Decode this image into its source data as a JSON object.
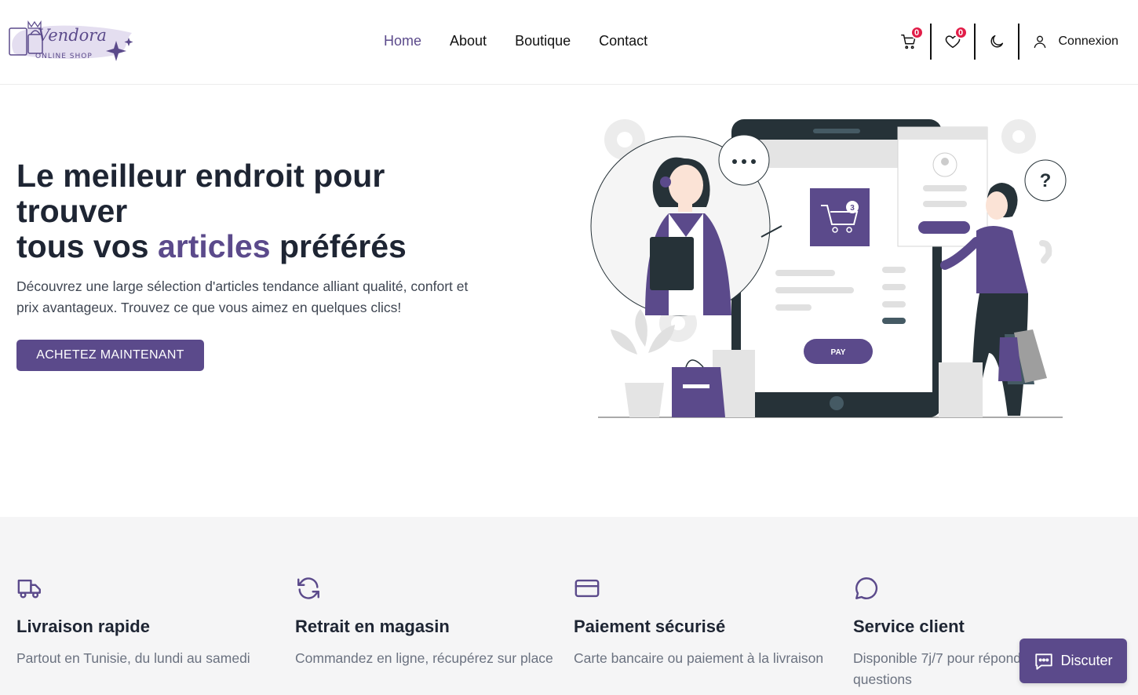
{
  "brand": {
    "logo_text": "Vendora",
    "logo_sub": "ONLINE SHOP"
  },
  "nav": {
    "home": "Home",
    "about": "About",
    "boutique": "Boutique",
    "contact": "Contact"
  },
  "header": {
    "cart_count": "0",
    "wishlist_count": "0",
    "login_label": "Connexion"
  },
  "hero": {
    "title_line1": "Le meilleur endroit pour trouver",
    "title_line2_a": "tous vos ",
    "title_accent": "articles",
    "title_line2_b": " préférés",
    "description": "Découvrez une large sélection d'articles tendance alliant qualité, confort et prix avantageux. Trouvez ce que vous aimez en quelques clics!",
    "cta_label": "ACHETEZ MAINTENANT",
    "illustration": {
      "pay_label": "PAY",
      "cart_count": "3",
      "question_mark": "?"
    }
  },
  "features": [
    {
      "icon": "truck-icon",
      "title": "Livraison rapide",
      "text": "Partout en Tunisie, du lundi au samedi"
    },
    {
      "icon": "refresh-icon",
      "title": "Retrait en magasin",
      "text": "Commandez en ligne, récupérez sur place"
    },
    {
      "icon": "credit-card-icon",
      "title": "Paiement sécurisé",
      "text": "Carte bancaire ou paiement à la livraison"
    },
    {
      "icon": "chat-bubble-icon",
      "title": "Service client",
      "text": "Disponible 7j/7 pour répondre à vos questions"
    }
  ],
  "chat": {
    "label": "Discuter"
  },
  "colors": {
    "accent": "#5b4a8b",
    "badge": "#e11d48",
    "dark": "#1e2533",
    "features_bg": "#f5f5f6"
  }
}
